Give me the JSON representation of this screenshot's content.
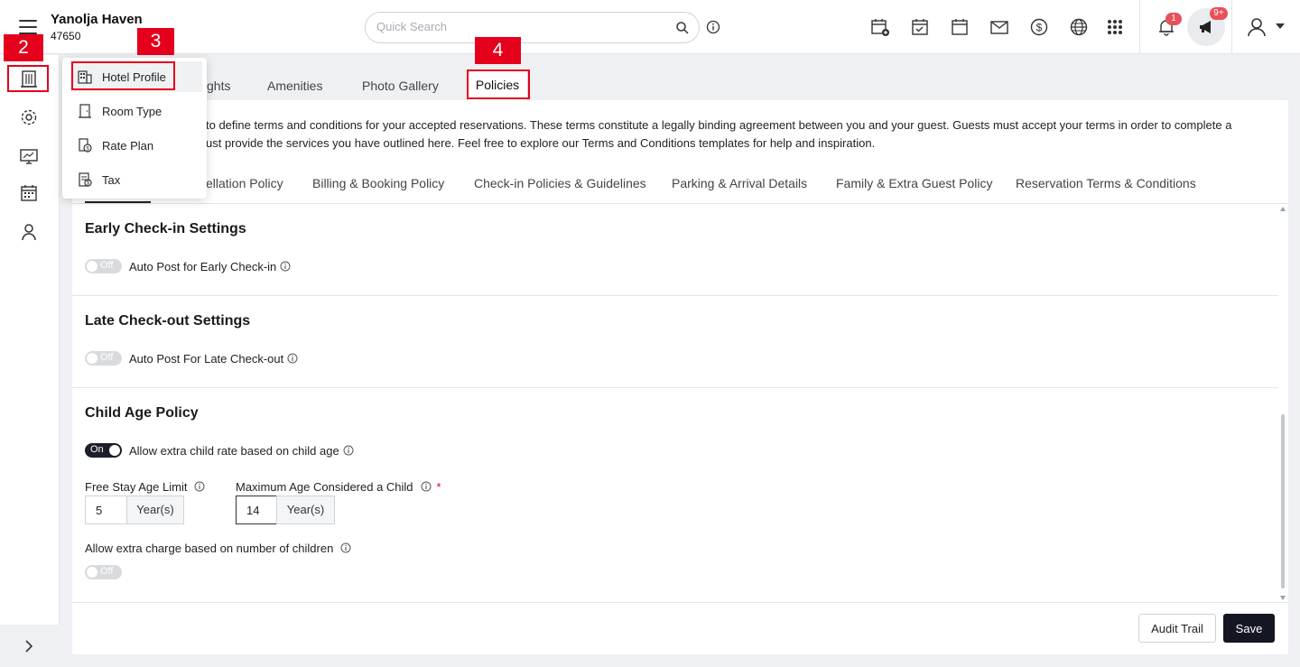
{
  "header": {
    "hotel_name": "Yanolja Haven",
    "hotel_id": "47650",
    "search_placeholder": "Quick Search",
    "notification_count": "1",
    "announcement_count": "9+",
    "icons": [
      "calendar-plus-icon",
      "calendar-check-icon",
      "calendar-icon",
      "mail-icon",
      "dollar-icon",
      "globe-icon",
      "apps-grid-icon",
      "bell-icon",
      "megaphone-icon",
      "user-icon"
    ]
  },
  "steps": {
    "step2": "2",
    "step3": "3",
    "step4": "4"
  },
  "menu": {
    "items": [
      {
        "label": "Hotel Profile",
        "icon": "building-icon"
      },
      {
        "label": "Room Type",
        "icon": "door-icon"
      },
      {
        "label": "Rate Plan",
        "icon": "rate-plan-icon"
      },
      {
        "label": "Tax",
        "icon": "tax-icon"
      }
    ]
  },
  "tabs": {
    "highlights_partial": "ghts",
    "amenities": "Amenities",
    "photo_gallery": "Photo Gallery",
    "policies": "Policies"
  },
  "policies": {
    "desc_line1": "to define terms and conditions for your accepted reservations. These terms constitute a legally binding agreement between you and your guest. Guests must accept your terms in order to complete a",
    "desc_line2": "ust provide the services you have outlined here. Feel free to explore our Terms and Conditions templates for help and inspiration.",
    "subtabs": [
      "ellation Policy",
      "Billing & Booking Policy",
      "Check-in Policies & Guidelines",
      "Parking & Arrival Details",
      "Family & Extra Guest Policy",
      "Reservation Terms & Conditions"
    ],
    "early_checkin": {
      "title": "Early Check-in Settings",
      "toggle_state": "Off",
      "toggle_label": "Auto Post for Early Check-in"
    },
    "late_checkout": {
      "title": "Late Check-out Settings",
      "toggle_state": "Off",
      "toggle_label": "Auto Post For Late Check-out"
    },
    "child_age": {
      "title": "Child Age Policy",
      "toggle_state": "On",
      "toggle_label": "Allow extra child rate based on child age",
      "free_stay_label": "Free Stay Age Limit",
      "free_stay_value": "5",
      "max_age_label": "Maximum Age Considered a Child",
      "max_age_value": "14",
      "unit": "Year(s)",
      "required_mark": "*",
      "extra_charge_label": "Allow extra charge based on number of children",
      "extra_charge_state": "Off"
    },
    "buttons": {
      "audit_trail": "Audit Trail",
      "save": "Save"
    }
  },
  "colors": {
    "accent_dark": "#141722",
    "step_red": "#e5001b",
    "badge_red": "#e8505b"
  }
}
